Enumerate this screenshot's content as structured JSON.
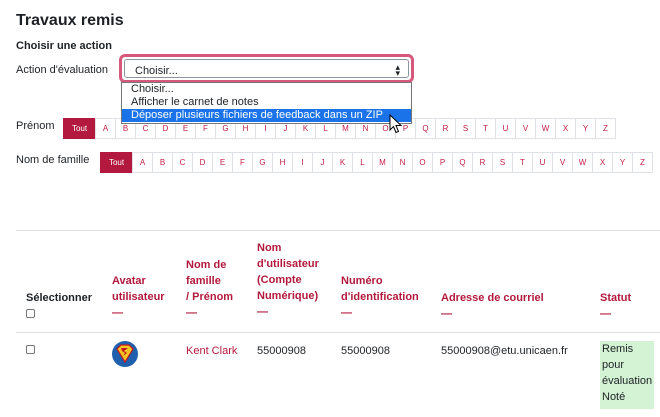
{
  "page": {
    "title": "Travaux remis",
    "subtitle": "Choisir une action"
  },
  "grading_action": {
    "label": "Action d'évaluation",
    "selected": "Choisir...",
    "options": [
      "Choisir...",
      "Afficher le carnet de notes",
      "Déposer plusieurs fichiers de feedback dans un ZIP"
    ],
    "highlighted_index": 2
  },
  "firstname_filter": {
    "label": "Prénom",
    "all_label": "Tout",
    "letters": [
      "A",
      "B",
      "C",
      "D",
      "E",
      "F",
      "G",
      "H",
      "I",
      "J",
      "K",
      "L",
      "M",
      "N",
      "O",
      "P",
      "Q",
      "R",
      "S",
      "T",
      "U",
      "V",
      "W",
      "X",
      "Y",
      "Z"
    ]
  },
  "lastname_filter": {
    "label": "Nom de famille",
    "all_label": "Tout",
    "letters": [
      "A",
      "B",
      "C",
      "D",
      "E",
      "F",
      "G",
      "H",
      "I",
      "J",
      "K",
      "L",
      "M",
      "N",
      "O",
      "P",
      "Q",
      "R",
      "S",
      "T",
      "U",
      "V",
      "W",
      "X",
      "Y",
      "Z"
    ]
  },
  "table": {
    "headers": {
      "select": "Sélectionner",
      "avatar_1": "Avatar",
      "avatar_2": "utilisateur",
      "name_1": "Nom de",
      "name_2": "famille",
      "name_3": "/ Prénom",
      "username_1": "Nom",
      "username_2": "d'utilisateur",
      "username_3": "(Compte",
      "username_4": "Numérique)",
      "idnumber_1": "Numéro",
      "idnumber_2": "d'identification",
      "email": "Adresse de courriel",
      "status": "Statut",
      "dash": "—"
    },
    "rows": [
      {
        "name": "Kent Clark",
        "username": "55000908",
        "idnumber": "55000908",
        "email": "55000908@etu.unicaen.fr",
        "status_1": "Remis",
        "status_2": "pour",
        "status_3": "évaluation",
        "status_4": "Noté"
      }
    ]
  },
  "colors": {
    "accent": "#b3193e",
    "focus_ring": "#d6597d",
    "option_highlight": "#1a73e8",
    "status_bg": "#d4f3d4"
  }
}
